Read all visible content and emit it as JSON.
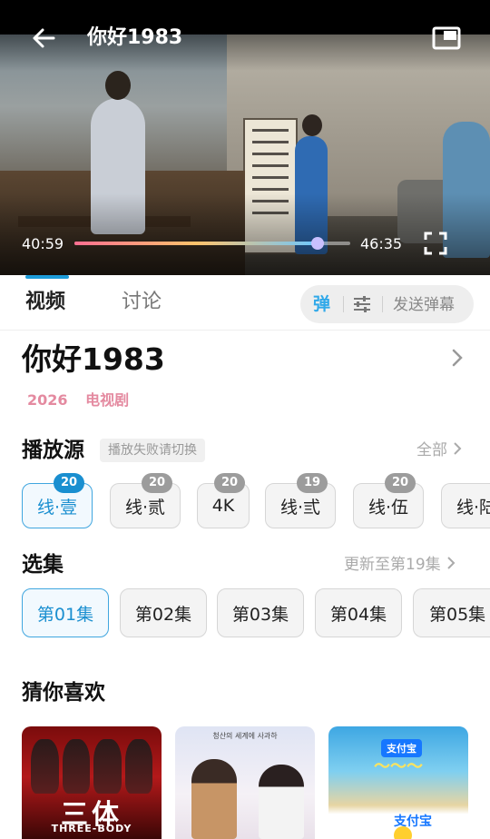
{
  "player": {
    "title": "你好1983",
    "current_time": "40:59",
    "total_time": "46:35",
    "progress": 0.88,
    "progress_colors": [
      "#ff6f91",
      "#ffc36b",
      "#6cc7ff"
    ]
  },
  "tabs": [
    {
      "label": "视频",
      "active": true
    },
    {
      "label": "讨论",
      "active": false
    }
  ],
  "danmaku": {
    "toggle_label": "弹",
    "send_placeholder": "发送弹幕"
  },
  "show": {
    "title": "你好1983",
    "year": "2026",
    "category": "电视剧"
  },
  "sources": {
    "title": "播放源",
    "hint": "播放失败请切换",
    "all_label": "全部",
    "items": [
      {
        "label": "线·壹",
        "badge": "20",
        "active": true
      },
      {
        "label": "线·贰",
        "badge": "20",
        "active": false
      },
      {
        "label": "4K",
        "badge": "20",
        "active": false
      },
      {
        "label": "线·弎",
        "badge": "19",
        "active": false
      },
      {
        "label": "线·伍",
        "badge": "20",
        "active": false
      },
      {
        "label": "线·陆",
        "badge": "",
        "active": false
      }
    ]
  },
  "episodes": {
    "title": "选集",
    "update_label": "更新至第19集",
    "items": [
      {
        "label": "第01集",
        "active": true
      },
      {
        "label": "第02集",
        "active": false
      },
      {
        "label": "第03集",
        "active": false
      },
      {
        "label": "第04集",
        "active": false
      },
      {
        "label": "第05集",
        "active": false
      }
    ]
  },
  "recommend": {
    "title": "猜你喜欢",
    "items": [
      {
        "poster_title": "三体",
        "poster_subtitle": "THREE-BODY"
      },
      {
        "poster_caption": "청산의 세계에 사과하"
      },
      {
        "poster_brand": "支付宝",
        "poster_brand_bottom": "支付宝"
      }
    ]
  },
  "colors": {
    "accent": "#1a8fd0",
    "meta_pink": "#e48aa0"
  }
}
